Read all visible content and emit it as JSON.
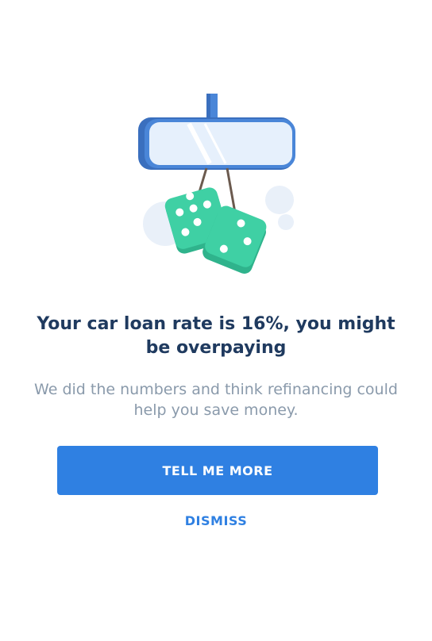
{
  "prompt": {
    "headline": "Your car loan rate is 16%, you might be overpaying",
    "subtext": "We did the numbers and think refinancing could help you save money.",
    "primary_button_label": "TELL ME MORE",
    "dismiss_label": "DISMISS"
  },
  "illustration": {
    "icon": "rearview-mirror-fuzzy-dice-icon",
    "colors": {
      "mirror_frame": "#4a86d8",
      "mirror_glass": "#e6f0fc",
      "dice": "#3fd0a4",
      "dice_shadow": "#2fb38c",
      "dice_pips": "#ffffff",
      "strings": "#6b5a4e",
      "bubbles": "#e9f0f9"
    }
  },
  "colors": {
    "headline": "#1f3a5f",
    "subtext": "#8a9aab",
    "accent": "#2f80e2"
  }
}
